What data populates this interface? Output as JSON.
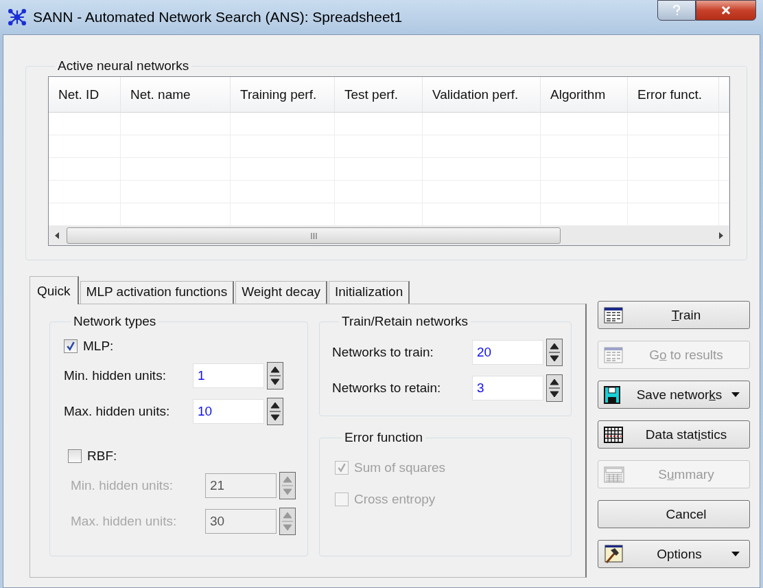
{
  "window": {
    "title": "SANN - Automated Network Search (ANS): Spreadsheet1"
  },
  "networks_group": {
    "title": "Active neural networks",
    "columns": [
      "Net. ID",
      "Net. name",
      "Training perf.",
      "Test perf.",
      "Validation perf.",
      "Algorithm",
      "Error funct."
    ]
  },
  "tabs": [
    {
      "label": "Quick",
      "selected": true
    },
    {
      "label": "MLP activation functions",
      "selected": false
    },
    {
      "label": "Weight decay",
      "selected": false
    },
    {
      "label": "Initialization",
      "selected": false
    }
  ],
  "network_types": {
    "title": "Network types",
    "types": [
      {
        "label": "MLP:",
        "checked": true,
        "fields": [
          {
            "label": "Min. hidden units:",
            "value": "1",
            "disabled": false
          },
          {
            "label": "Max. hidden units:",
            "value": "10",
            "disabled": false
          }
        ]
      },
      {
        "label": "RBF:",
        "checked": false,
        "fields": [
          {
            "label": "Min. hidden units:",
            "value": "21",
            "disabled": true
          },
          {
            "label": "Max. hidden units:",
            "value": "30",
            "disabled": true
          }
        ]
      }
    ]
  },
  "train_retain": {
    "title": "Train/Retain networks",
    "fields": [
      {
        "label": "Networks to train:",
        "value": "20",
        "disabled": false
      },
      {
        "label": "Networks to retain:",
        "value": "3",
        "disabled": false
      }
    ]
  },
  "error_function": {
    "title": "Error function",
    "options": [
      {
        "label": "Sum of squares",
        "checked": true,
        "disabled": true
      },
      {
        "label": "Cross entropy",
        "checked": false,
        "disabled": true
      }
    ]
  },
  "buttons": [
    {
      "label": {
        "key": "T",
        "after": "rain"
      },
      "disabled": false,
      "dropdown": false
    },
    {
      "label": {
        "before": "G",
        "key": "o",
        "after": " to results"
      },
      "disabled": true,
      "dropdown": false
    },
    {
      "label": {
        "before": "Save networ",
        "key": "k",
        "after": "s"
      },
      "disabled": false,
      "dropdown": true
    },
    {
      "label": {
        "before": "Data stat",
        "key": "i",
        "after": "stics"
      },
      "disabled": false,
      "dropdown": false
    },
    {
      "label": {
        "before": "S",
        "key": "u",
        "after": "mmary"
      },
      "disabled": true,
      "dropdown": false
    },
    {
      "label": {
        "before": "Cancel"
      },
      "disabled": false,
      "dropdown": false
    },
    {
      "label": {
        "before": "Options"
      },
      "disabled": false,
      "dropdown": true
    }
  ]
}
